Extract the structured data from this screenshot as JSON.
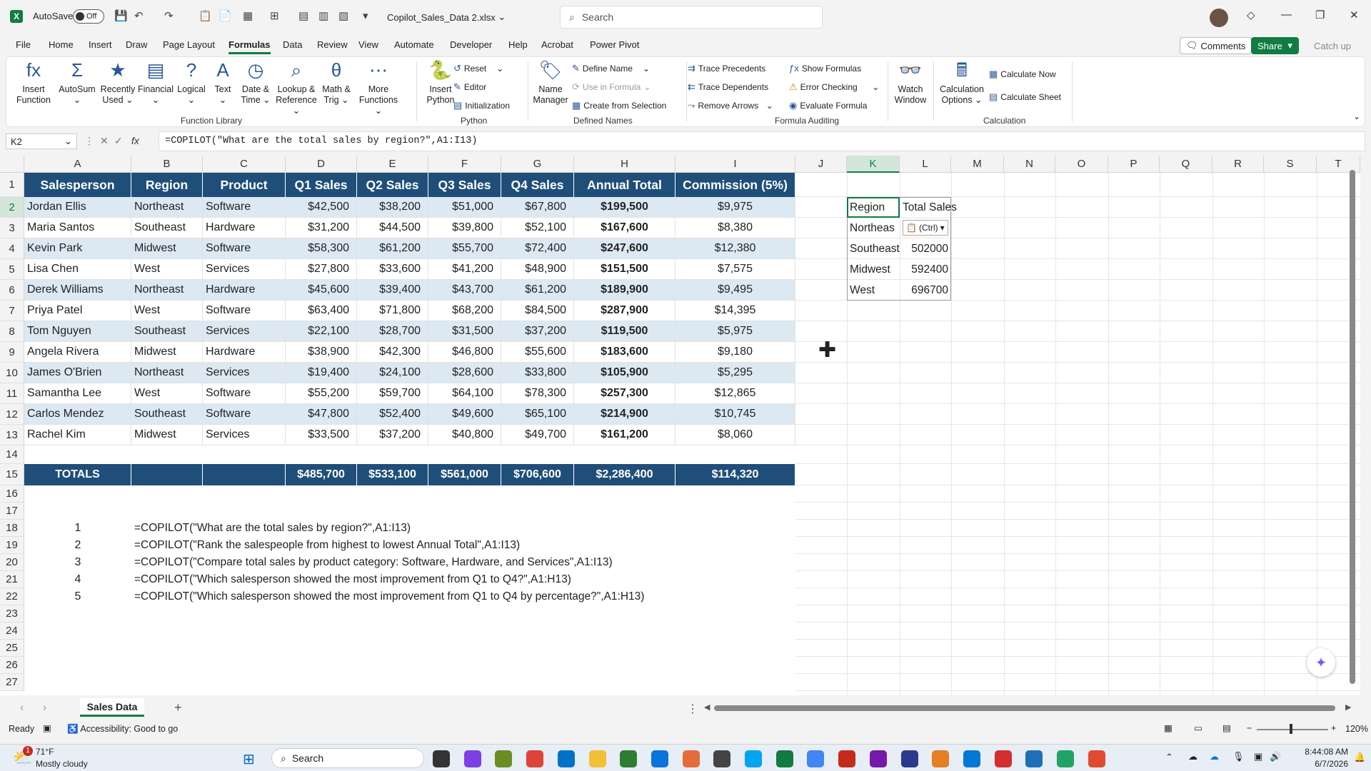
{
  "titlebar": {
    "autosave_label": "AutoSave",
    "autosave_state": "Off",
    "filename": "Copilot_Sales_Data 2.xlsx",
    "search_placeholder": "Search"
  },
  "menu": {
    "items": [
      "File",
      "Home",
      "Insert",
      "Draw",
      "Page Layout",
      "Formulas",
      "Data",
      "Review",
      "View",
      "Automate",
      "Developer",
      "Help",
      "Acrobat",
      "Power Pivot"
    ],
    "active": "Formulas",
    "comments": "Comments",
    "share": "Share",
    "catchup": "Catch up"
  },
  "ribbon": {
    "function_library": {
      "label": "Function Library",
      "buttons": [
        {
          "l1": "Insert",
          "l2": "Function",
          "icon": "fx"
        },
        {
          "l1": "AutoSum",
          "l2": "⌄",
          "icon": "Σ"
        },
        {
          "l1": "Recently",
          "l2": "Used ⌄",
          "icon": "★"
        },
        {
          "l1": "Financial",
          "l2": "⌄",
          "icon": "▤"
        },
        {
          "l1": "Logical",
          "l2": "⌄",
          "icon": "?"
        },
        {
          "l1": "Text",
          "l2": "⌄",
          "icon": "A"
        },
        {
          "l1": "Date &",
          "l2": "Time ⌄",
          "icon": "◷"
        },
        {
          "l1": "Lookup &",
          "l2": "Reference ⌄",
          "icon": "⌕"
        },
        {
          "l1": "Math &",
          "l2": "Trig ⌄",
          "icon": "θ"
        },
        {
          "l1": "More",
          "l2": "Functions ⌄",
          "icon": "⋯"
        }
      ]
    },
    "python": {
      "label": "Python",
      "insert_l1": "Insert",
      "insert_l2": "Python",
      "reset": "Reset",
      "editor": "Editor",
      "init": "Initialization"
    },
    "defined_names": {
      "label": "Defined Names",
      "manager_l1": "Name",
      "manager_l2": "Manager",
      "define": "Define Name",
      "use": "Use in Formula",
      "create": "Create from Selection"
    },
    "auditing": {
      "label": "Formula Auditing",
      "precedents": "Trace Precedents",
      "dependents": "Trace Dependents",
      "remove": "Remove Arrows",
      "show": "Show Formulas",
      "errors": "Error Checking",
      "evaluate": "Evaluate Formula",
      "watch_l1": "Watch",
      "watch_l2": "Window"
    },
    "calculation": {
      "label": "Calculation",
      "options_l1": "Calculation",
      "options_l2": "Options ⌄",
      "now": "Calculate Now",
      "sheet": "Calculate Sheet"
    }
  },
  "formula_bar": {
    "namebox": "K2",
    "fx": "fx",
    "formula": "=COPILOT(\"What are the total sales by region?\",A1:I13)"
  },
  "columns": [
    "A",
    "B",
    "C",
    "D",
    "E",
    "F",
    "G",
    "H",
    "I",
    "J",
    "K",
    "L",
    "M",
    "N",
    "O",
    "P",
    "Q",
    "R",
    "S",
    "T"
  ],
  "rows": [
    "1",
    "2",
    "3",
    "4",
    "5",
    "6",
    "7",
    "8",
    "9",
    "10",
    "11",
    "12",
    "13",
    "14",
    "15",
    "16",
    "17",
    "18",
    "19",
    "20",
    "21",
    "22",
    "23",
    "24",
    "25",
    "26",
    "27"
  ],
  "table": {
    "headers": [
      "Salesperson",
      "Region",
      "Product",
      "Q1 Sales",
      "Q2 Sales",
      "Q3 Sales",
      "Q4 Sales",
      "Annual Total",
      "Commission (5%)"
    ],
    "data": [
      [
        "Jordan Ellis",
        "Northeast",
        "Software",
        "$42,500",
        "$38,200",
        "$51,000",
        "$67,800",
        "$199,500",
        "$9,975"
      ],
      [
        "Maria Santos",
        "Southeast",
        "Hardware",
        "$31,200",
        "$44,500",
        "$39,800",
        "$52,100",
        "$167,600",
        "$8,380"
      ],
      [
        "Kevin Park",
        "Midwest",
        "Software",
        "$58,300",
        "$61,200",
        "$55,700",
        "$72,400",
        "$247,600",
        "$12,380"
      ],
      [
        "Lisa Chen",
        "West",
        "Services",
        "$27,800",
        "$33,600",
        "$41,200",
        "$48,900",
        "$151,500",
        "$7,575"
      ],
      [
        "Derek Williams",
        "Northeast",
        "Hardware",
        "$45,600",
        "$39,400",
        "$43,700",
        "$61,200",
        "$189,900",
        "$9,495"
      ],
      [
        "Priya Patel",
        "West",
        "Software",
        "$63,400",
        "$71,800",
        "$68,200",
        "$84,500",
        "$287,900",
        "$14,395"
      ],
      [
        "Tom Nguyen",
        "Southeast",
        "Services",
        "$22,100",
        "$28,700",
        "$31,500",
        "$37,200",
        "$119,500",
        "$5,975"
      ],
      [
        "Angela Rivera",
        "Midwest",
        "Hardware",
        "$38,900",
        "$42,300",
        "$46,800",
        "$55,600",
        "$183,600",
        "$9,180"
      ],
      [
        "James O'Brien",
        "Northeast",
        "Services",
        "$19,400",
        "$24,100",
        "$28,600",
        "$33,800",
        "$105,900",
        "$5,295"
      ],
      [
        "Samantha Lee",
        "West",
        "Software",
        "$55,200",
        "$59,700",
        "$64,100",
        "$78,300",
        "$257,300",
        "$12,865"
      ],
      [
        "Carlos Mendez",
        "Southeast",
        "Software",
        "$47,800",
        "$52,400",
        "$49,600",
        "$65,100",
        "$214,900",
        "$10,745"
      ],
      [
        "Rachel Kim",
        "Midwest",
        "Services",
        "$33,500",
        "$37,200",
        "$40,800",
        "$49,700",
        "$161,200",
        "$8,060"
      ]
    ],
    "totals": [
      "TOTALS",
      "",
      "",
      "$485,700",
      "$533,100",
      "$561,000",
      "$706,600",
      "$2,286,400",
      "$114,320"
    ]
  },
  "prompts": [
    {
      "n": "1",
      "text": "=COPILOT(\"What are the total sales by region?\",A1:I13)"
    },
    {
      "n": "2",
      "text": "=COPILOT(\"Rank the salespeople from highest to lowest Annual Total\",A1:I13)"
    },
    {
      "n": "3",
      "text": "=COPILOT(\"Compare total sales by product category: Software, Hardware, and Services\",A1:I13)"
    },
    {
      "n": "4",
      "text": "=COPILOT(\"Which salesperson showed the most improvement from Q1 to Q4?\",A1:H13)"
    },
    {
      "n": "5",
      "text": "=COPILOT(\"Which salesperson showed the most improvement from Q1 to Q4 by percentage?\",A1:H13)"
    }
  ],
  "copilot_result": {
    "header": [
      "Region",
      "Total Sales"
    ],
    "rows": [
      [
        "Northeas",
        ""
      ],
      [
        "Southeast",
        "502000"
      ],
      [
        "Midwest",
        "592400"
      ],
      [
        "West",
        "696700"
      ]
    ],
    "paste_label": "(Ctrl)"
  },
  "sheet_tab": "Sales Data",
  "status": {
    "ready": "Ready",
    "accessibility": "Accessibility: Good to go",
    "zoom": "120%"
  },
  "taskbar": {
    "temp": "71°F",
    "weather": "Mostly cloudy",
    "search": "Search",
    "time": "8:44:08 AM",
    "date": "6/7/2026",
    "badge": "1"
  }
}
